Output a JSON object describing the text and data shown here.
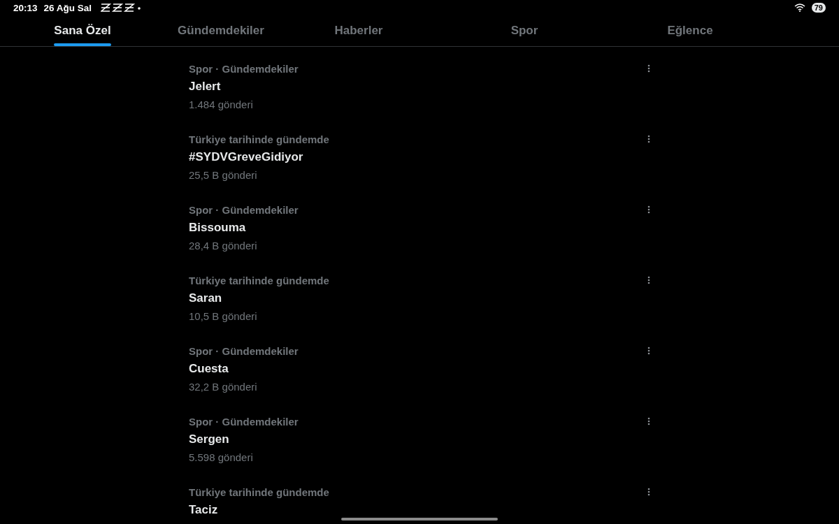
{
  "status_bar": {
    "time": "20:13",
    "date": "26 Ağu Sal",
    "battery": "79"
  },
  "tabs": [
    {
      "label": "Sana Özel",
      "selected": true
    },
    {
      "label": "Gündemdekiler",
      "selected": false
    },
    {
      "label": "Haberler",
      "selected": false
    },
    {
      "label": "Spor",
      "selected": false
    },
    {
      "label": "Eğlence",
      "selected": false
    }
  ],
  "trends": [
    {
      "context": "Spor · Gündemdekiler",
      "title": "Jelert",
      "count": "1.484 gönderi"
    },
    {
      "context": "Türkiye tarihinde gündemde",
      "title": "#SYDVGreveGidiyor",
      "count": "25,5 B gönderi"
    },
    {
      "context": "Spor · Gündemdekiler",
      "title": "Bissouma",
      "count": "28,4 B gönderi"
    },
    {
      "context": "Türkiye tarihinde gündemde",
      "title": "Saran",
      "count": "10,5 B gönderi"
    },
    {
      "context": "Spor · Gündemdekiler",
      "title": "Cuesta",
      "count": "32,2 B gönderi"
    },
    {
      "context": "Spor · Gündemdekiler",
      "title": "Sergen",
      "count": "5.598 gönderi"
    },
    {
      "context": "Türkiye tarihinde gündemde",
      "title": "Taciz"
    }
  ]
}
